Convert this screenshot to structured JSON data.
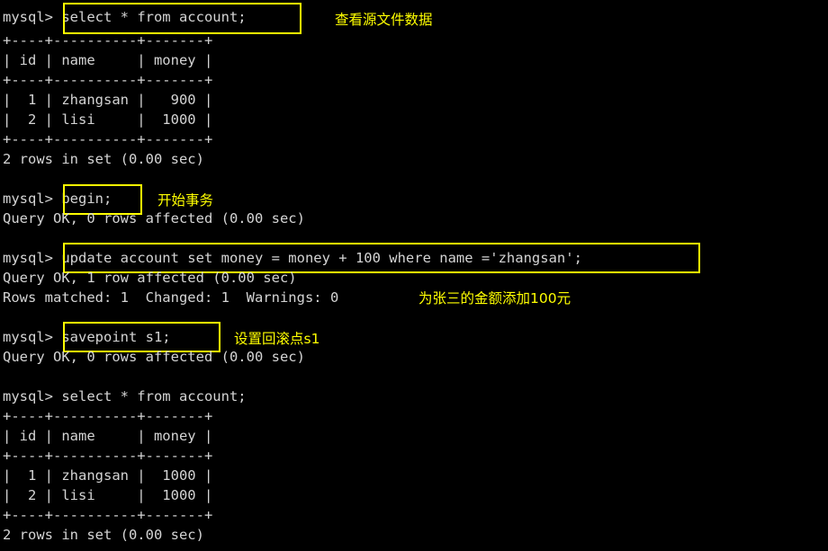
{
  "terminal": {
    "prompt": "mysql>",
    "background_color": "#000000",
    "text_color": "#d4d4d4",
    "highlight_color": "#ffff00",
    "annotation_color": "#ffff00"
  },
  "session": {
    "lines": [
      {
        "id": "l1",
        "type": "prompt",
        "text": "mysql> select * from account;"
      },
      {
        "id": "l2",
        "type": "output",
        "text": "+----+----------+-------+"
      },
      {
        "id": "l3",
        "type": "output",
        "text": "| id | name     | money |"
      },
      {
        "id": "l4",
        "type": "output",
        "text": "+----+----------+-------+"
      },
      {
        "id": "l5",
        "type": "output",
        "text": "|  1 | zhangsan |   900 |"
      },
      {
        "id": "l6",
        "type": "output",
        "text": "|  2 | lisi     |  1000 |"
      },
      {
        "id": "l7",
        "type": "output",
        "text": "+----+----------+-------+"
      },
      {
        "id": "l8",
        "type": "output",
        "text": "2 rows in set (0.00 sec)"
      },
      {
        "id": "l9",
        "type": "blank",
        "text": ""
      },
      {
        "id": "l10",
        "type": "prompt",
        "text": "mysql> begin;"
      },
      {
        "id": "l11",
        "type": "output",
        "text": "Query OK, 0 rows affected (0.00 sec)"
      },
      {
        "id": "l12",
        "type": "blank",
        "text": ""
      },
      {
        "id": "l13",
        "type": "prompt",
        "text": "mysql> update account set money = money + 100 where name ='zhangsan';"
      },
      {
        "id": "l14",
        "type": "output",
        "text": "Query OK, 1 row affected (0.00 sec)"
      },
      {
        "id": "l15",
        "type": "output",
        "text": "Rows matched: 1  Changed: 1  Warnings: 0"
      },
      {
        "id": "l16",
        "type": "blank",
        "text": ""
      },
      {
        "id": "l17",
        "type": "prompt",
        "text": "mysql> savepoint s1;"
      },
      {
        "id": "l18",
        "type": "output",
        "text": "Query OK, 0 rows affected (0.00 sec)"
      },
      {
        "id": "l19",
        "type": "blank",
        "text": ""
      },
      {
        "id": "l20",
        "type": "prompt",
        "text": "mysql> select * from account;"
      },
      {
        "id": "l21",
        "type": "output",
        "text": "+----+----------+-------+"
      },
      {
        "id": "l22",
        "type": "output",
        "text": "| id | name     | money |"
      },
      {
        "id": "l23",
        "type": "output",
        "text": "+----+----------+-------+"
      },
      {
        "id": "l24",
        "type": "output",
        "text": "|  1 | zhangsan |  1000 |"
      },
      {
        "id": "l25",
        "type": "output",
        "text": "|  2 | lisi     |  1000 |"
      },
      {
        "id": "l26",
        "type": "output",
        "text": "+----+----------+-------+"
      },
      {
        "id": "l27",
        "type": "output",
        "text": "2 rows in set (0.00 sec)"
      }
    ]
  },
  "highlighted_commands": [
    {
      "id": "hc1",
      "command": "select * from account;"
    },
    {
      "id": "hc2",
      "command": "begin;"
    },
    {
      "id": "hc3",
      "command": "update account set money = money + 100 where name ='zhangsan';"
    },
    {
      "id": "hc4",
      "command": "savepoint s1;"
    }
  ],
  "annotations": [
    {
      "id": "a1",
      "text": "查看源文件数据"
    },
    {
      "id": "a2",
      "text": "开始事务"
    },
    {
      "id": "a3",
      "text": "为张三的金额添加100元"
    },
    {
      "id": "a4",
      "text": "设置回滚点s1"
    }
  ],
  "result_tables": [
    {
      "id": "t1",
      "columns": [
        "id",
        "name",
        "money"
      ],
      "rows": [
        [
          "1",
          "zhangsan",
          "900"
        ],
        [
          "2",
          "lisi",
          "1000"
        ]
      ],
      "footer": "2 rows in set (0.00 sec)"
    },
    {
      "id": "t2",
      "columns": [
        "id",
        "name",
        "money"
      ],
      "rows": [
        [
          "1",
          "zhangsan",
          "1000"
        ],
        [
          "2",
          "lisi",
          "1000"
        ]
      ],
      "footer": "2 rows in set (0.00 sec)"
    }
  ]
}
